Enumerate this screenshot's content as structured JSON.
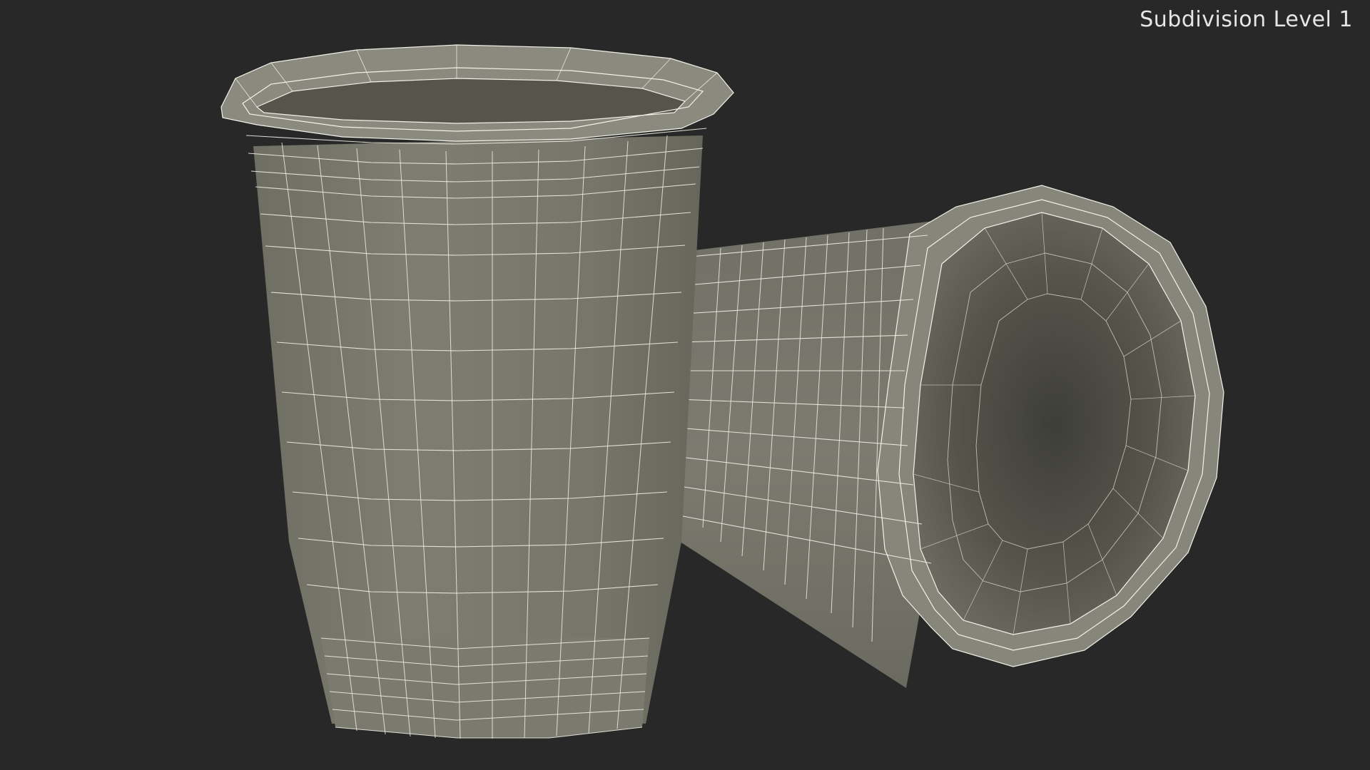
{
  "viewport": {
    "overlay_label": "Subdivision Level 1"
  },
  "model": {
    "style": "wireframe-over-shaded",
    "surface_color": "#7a7a6e",
    "wire_color": "#f2f2ea",
    "background_color": "#282828"
  }
}
